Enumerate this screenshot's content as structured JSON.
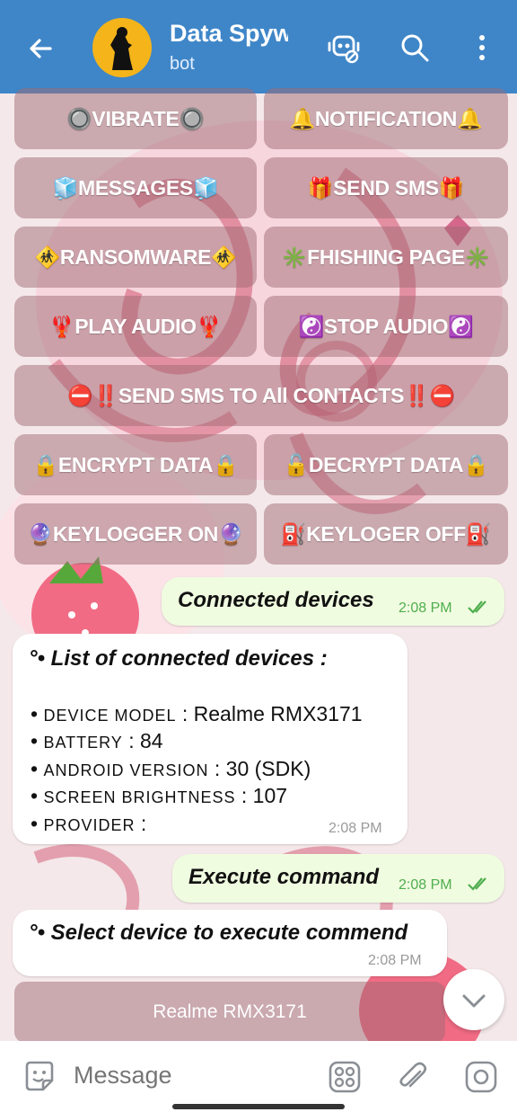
{
  "header": {
    "title": "Data Spyw",
    "subtitle": "bot",
    "icons": [
      "back-arrow-icon",
      "bot-avatar",
      "voice-chat-icon",
      "search-icon",
      "more-vert-icon"
    ],
    "bg_color": "#3f86c8"
  },
  "keyboard": {
    "rows": [
      [
        "🔘VIBRATE🔘",
        "🔔NOTIFICATION🔔"
      ],
      [
        "🧊MESSAGES🧊",
        "🎁SEND SMS🎁"
      ],
      [
        "🚸RANSOMWARE🚸",
        "✳️FHISHING PAGE✳️"
      ],
      [
        "🦞PLAY AUDIO🦞",
        "☯️STOP AUDIO☯️"
      ],
      [
        "⛔‼️SEND SMS TO All CONTACTS‼️⛔"
      ],
      [
        "🔒ENCRYPT DATA🔒",
        "🔓DECRYPT DATA🔒"
      ],
      [
        "🔮KEYLOGGER ON🔮",
        "⛽KEYLOGER OFF⛽"
      ]
    ]
  },
  "messages": {
    "out1": {
      "text": "Connected devices",
      "time": "2:08 PM"
    },
    "in1": {
      "title": "°• List of connected devices :",
      "rows": [
        {
          "bullet": "•",
          "key": "Device Model",
          "value": "Realme RMX3171"
        },
        {
          "bullet": "•",
          "key": "Battery",
          "value": "84"
        },
        {
          "bullet": "•",
          "key": "Android Version",
          "value": "30 (SDK)"
        },
        {
          "bullet": "•",
          "key": "Screen Brightness",
          "value": "107"
        },
        {
          "bullet": "•",
          "key": "Provider",
          "value": ""
        }
      ],
      "time": "2:08 PM"
    },
    "out2": {
      "text": "Execute command",
      "time": "2:08 PM"
    },
    "in2": {
      "title": "°• Select device to execute commend",
      "time": "2:08 PM"
    },
    "device_button": "Realme RMX3171"
  },
  "input": {
    "placeholder": "Message"
  }
}
